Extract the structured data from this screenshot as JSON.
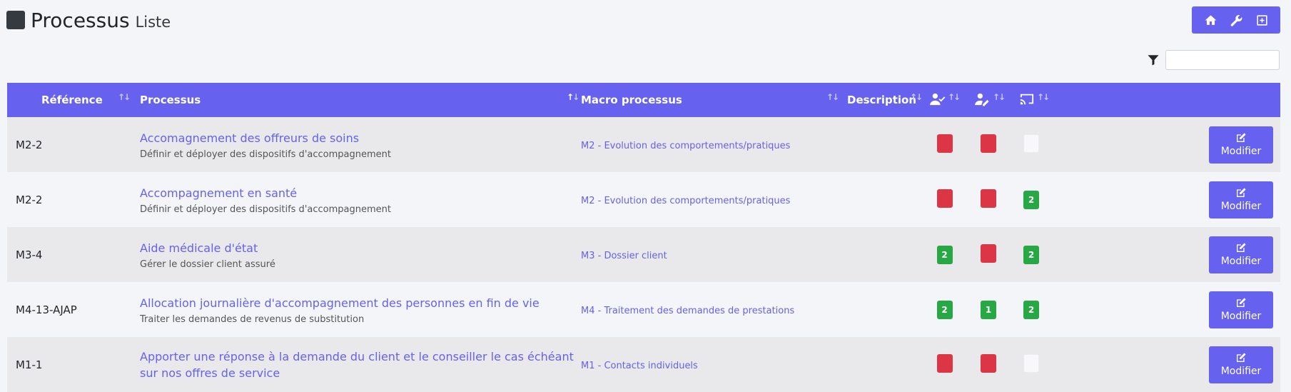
{
  "header": {
    "title": "Processus",
    "subtitle": "Liste"
  },
  "toolbar": {
    "buttons": [
      "home-icon",
      "wrench-icon",
      "plus-square-icon"
    ]
  },
  "filter": {
    "icon": "filter-icon",
    "value": "",
    "placeholder": ""
  },
  "table": {
    "columns": {
      "reference": "Référence",
      "processus": "Processus",
      "macro": "Macro processus",
      "description": "Description",
      "col_user_check": "user-check-icon",
      "col_user_edit": "user-edit-icon",
      "col_cast": "cast-icon"
    },
    "rows": [
      {
        "ref": "M2-2",
        "name": "Accomagnement des offreurs de soins",
        "desc": "Définir et déployer des dispositifs d'accompagnement",
        "macro": "M2 - Evolution des comportements/pratiques",
        "b1": {
          "color": "red",
          "text": ""
        },
        "b2": {
          "color": "red",
          "text": ""
        },
        "b3": {
          "color": "empty",
          "text": ""
        },
        "action": "Modifier"
      },
      {
        "ref": "M2-2",
        "name": "Accompagnement en santé",
        "desc": "Définir et déployer des dispositifs d'accompagnement",
        "macro": "M2 - Evolution des comportements/pratiques",
        "b1": {
          "color": "red",
          "text": ""
        },
        "b2": {
          "color": "red",
          "text": ""
        },
        "b3": {
          "color": "green",
          "text": "2"
        },
        "action": "Modifier"
      },
      {
        "ref": "M3-4",
        "name": "Aide médicale d'état",
        "desc": "Gérer le dossier client assuré",
        "macro": "M3 - Dossier client",
        "b1": {
          "color": "green",
          "text": "2"
        },
        "b2": {
          "color": "red",
          "text": ""
        },
        "b3": {
          "color": "green",
          "text": "2"
        },
        "action": "Modifier"
      },
      {
        "ref": "M4-13-AJAP",
        "name": "Allocation journalière d'accompagnement des personnes en fin de vie",
        "desc": "Traiter les demandes de revenus de substitution",
        "macro": "M4 - Traitement des demandes de prestations",
        "b1": {
          "color": "green",
          "text": "2"
        },
        "b2": {
          "color": "green",
          "text": "1"
        },
        "b3": {
          "color": "green",
          "text": "2"
        },
        "action": "Modifier"
      },
      {
        "ref": "M1-1",
        "name": "Apporter une réponse à la demande du client et le conseiller le cas échéant sur nos offres de service",
        "desc": "",
        "macro": "M1 - Contacts individuels",
        "b1": {
          "color": "red",
          "text": ""
        },
        "b2": {
          "color": "red",
          "text": ""
        },
        "b3": {
          "color": "empty",
          "text": ""
        },
        "action": "Modifier"
      }
    ]
  },
  "colors": {
    "accent": "#6661ef",
    "red": "#dc3545",
    "green": "#28a745"
  }
}
